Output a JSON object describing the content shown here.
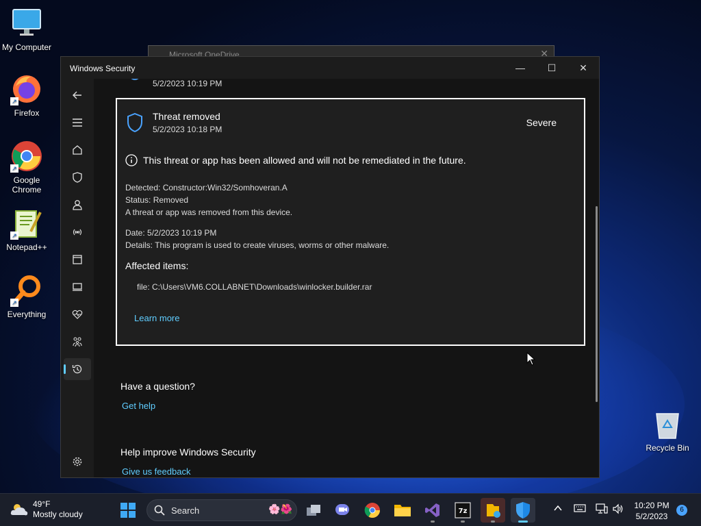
{
  "desktop": {
    "icons": [
      {
        "label": "My Computer"
      },
      {
        "label": "Firefox"
      },
      {
        "label": "Google Chrome"
      },
      {
        "label": "Notepad++"
      },
      {
        "label": "Everything"
      }
    ],
    "recycle_bin": "Recycle Bin"
  },
  "background_window": {
    "title": "Microsoft OneDrive"
  },
  "window": {
    "title": "Windows Security",
    "controls": {
      "minimize": "—",
      "maximize": "☐",
      "close": "✕"
    }
  },
  "nav": [
    {
      "name": "back-icon"
    },
    {
      "name": "menu-icon"
    },
    {
      "name": "home-icon"
    },
    {
      "name": "shield-icon"
    },
    {
      "name": "account-icon"
    },
    {
      "name": "network-icon"
    },
    {
      "name": "app-browser-icon"
    },
    {
      "name": "device-icon"
    },
    {
      "name": "health-icon"
    },
    {
      "name": "family-icon"
    },
    {
      "name": "history-icon"
    },
    {
      "name": "settings-icon"
    }
  ],
  "content": {
    "previous_item_date": "5/2/2023 10:19 PM",
    "threat": {
      "title": "Threat removed",
      "date": "5/2/2023 10:18 PM",
      "severity": "Severe",
      "notice": "This threat or app has been allowed and will not be remediated in the future.",
      "detected": "Detected:  Constructor:Win32/Somhoveran.A",
      "status": "Status:  Removed",
      "status_desc": "A threat or app was removed from this device.",
      "date_line": "Date:  5/2/2023 10:19 PM",
      "details": "Details:  This program is used to create viruses, worms or other malware.",
      "affected_heading": "Affected items:",
      "affected_file": "file: C:\\Users\\VM6.COLLABNET\\Downloads\\winlocker.builder.rar",
      "learn_more": "Learn more"
    },
    "question_heading": "Have a question?",
    "get_help": "Get help",
    "improve_heading": "Help improve Windows Security",
    "feedback": "Give us feedback"
  },
  "taskbar": {
    "weather_temp": "49°F",
    "weather_desc": "Mostly cloudy",
    "search_placeholder": "Search",
    "time": "10:20 PM",
    "date": "5/2/2023",
    "notification_count": "6"
  },
  "colors": {
    "accent": "#60cdff",
    "window_bg": "#1c1c1c",
    "card_border": "#ffffff"
  }
}
